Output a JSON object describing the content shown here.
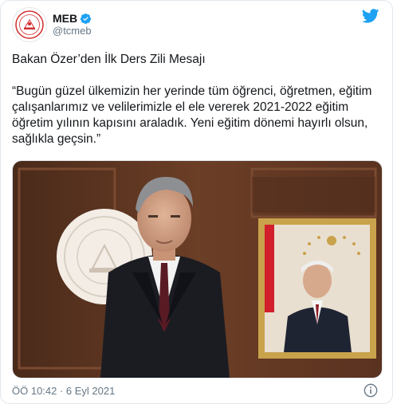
{
  "account": {
    "display_name": "MEB",
    "handle": "@tcmeb",
    "verified": true
  },
  "tweet": {
    "title": "Bakan Özer’den İlk Ders Zili Mesajı",
    "quote": "“Bugün güzel ülkemizin her yerinde tüm öğrenci, öğretmen, eğitim çalışanlarımız ve velilerimizle el ele vererek 2021-2022 eğitim öğretim yılının kapısını araladık. Yeni eğitim dönemi hayırlı olsun, sağlıkla geçsin.”",
    "timestamp": "ÖÖ 10:42 · 6 Eyl 2021"
  },
  "colors": {
    "twitter_blue": "#1da1f2",
    "secondary_text": "#657786",
    "logo_red": "#d32f2f"
  },
  "icons": {
    "brand": "twitter-bird-icon",
    "verified": "verified-badge-icon",
    "info": "info-icon"
  }
}
